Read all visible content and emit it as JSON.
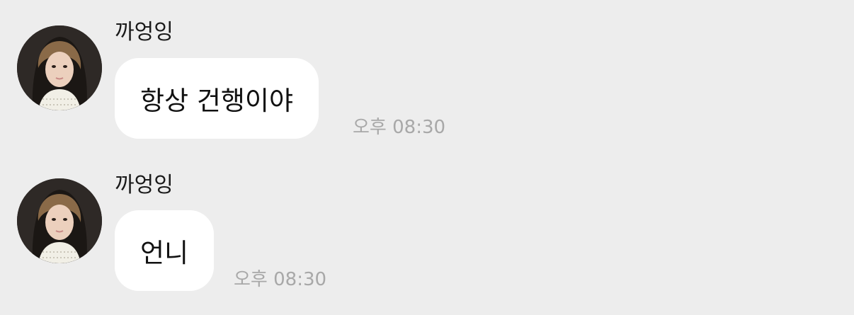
{
  "colors": {
    "background": "#ededed",
    "bubble": "#ffffff",
    "timestamp": "#a8a8a8"
  },
  "messages": [
    {
      "sender": "까엉잉",
      "text": "항상 건행이야",
      "time": "오후 08:30",
      "avatar_icon": "profile-photo"
    },
    {
      "sender": "까엉잉",
      "text": "언니",
      "time": "오후 08:30",
      "avatar_icon": "profile-photo"
    }
  ]
}
